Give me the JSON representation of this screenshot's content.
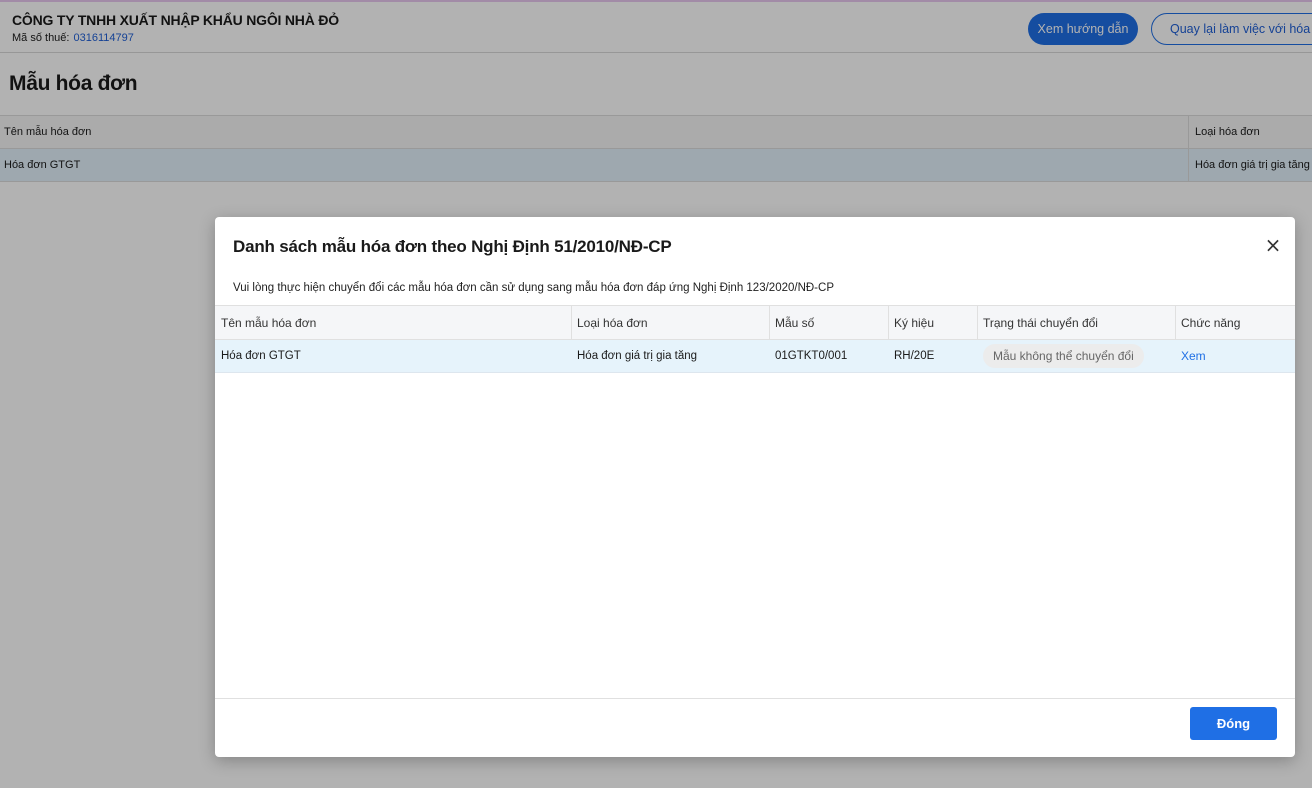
{
  "header": {
    "company_name": "CÔNG TY TNHH XUẤT NHẬP KHẨU NGÔI NHÀ ĐỎ",
    "tax_label": "Mã số thuế:",
    "tax_value": "0316114797",
    "guide_button": "Xem hướng dẫn",
    "back_button": "Quay lại làm việc với hóa đơn"
  },
  "page": {
    "title": "Mẫu hóa đơn",
    "table": {
      "columns": [
        "Tên mẫu hóa đơn",
        "Loại hóa đơn"
      ],
      "rows": [
        [
          "Hóa đơn GTGT",
          "Hóa đơn giá trị gia tăng"
        ]
      ]
    }
  },
  "modal": {
    "title": "Danh sách mẫu hóa đơn theo Nghị Định 51/2010/NĐ-CP",
    "description": "Vui lòng thực hiện chuyển đổi các mẫu hóa đơn cần sử dụng sang mẫu hóa đơn đáp ứng Nghị Định 123/2020/NĐ-CP",
    "close_icon": "×",
    "table": {
      "columns": [
        "Tên mẫu hóa đơn",
        "Loại hóa đơn",
        "Mẫu số",
        "Ký hiệu",
        "Trạng thái chuyển đổi",
        "Chức năng"
      ],
      "rows": [
        {
          "name": "Hóa đơn GTGT",
          "type": "Hóa đơn giá trị gia tăng",
          "form": "01GTKT0/001",
          "symbol": "RH/20E",
          "status": "Mẫu không thể chuyển đổi",
          "action": "Xem"
        }
      ]
    },
    "footer_button": "Đóng"
  }
}
